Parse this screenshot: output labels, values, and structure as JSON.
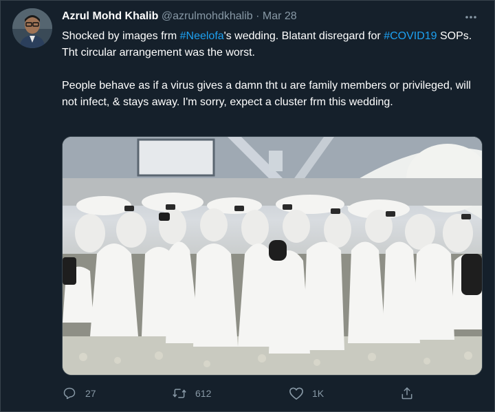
{
  "tweet": {
    "author_name": "Azrul Mohd Khalib",
    "author_handle": "@azrulmohdkhalib",
    "separator": "·",
    "date": "Mar 28",
    "text_p1_a": "Shocked by images frm ",
    "hashtag_1": "#Neelofa",
    "text_p1_b": "'s wedding. Blatant disregard for ",
    "hashtag_2": "#COVID19",
    "text_p1_c": " SOPs. Tht circular arrangement was the worst.",
    "text_p2": "People behave as if a virus gives a damn tht u are family members or privileged, will not infect, & stays away. I'm sorry, expect a cluster frm this wedding."
  },
  "actions": {
    "reply_count": "27",
    "retweet_count": "612",
    "like_count": "1K"
  },
  "colors": {
    "background": "#15202b",
    "text": "#ffffff",
    "muted": "#8899a6",
    "link": "#1da1f2"
  },
  "icons": {
    "more": "more-dots-icon",
    "reply": "reply-bubble-icon",
    "retweet": "retweet-icon",
    "like": "heart-icon",
    "share": "share-icon"
  }
}
